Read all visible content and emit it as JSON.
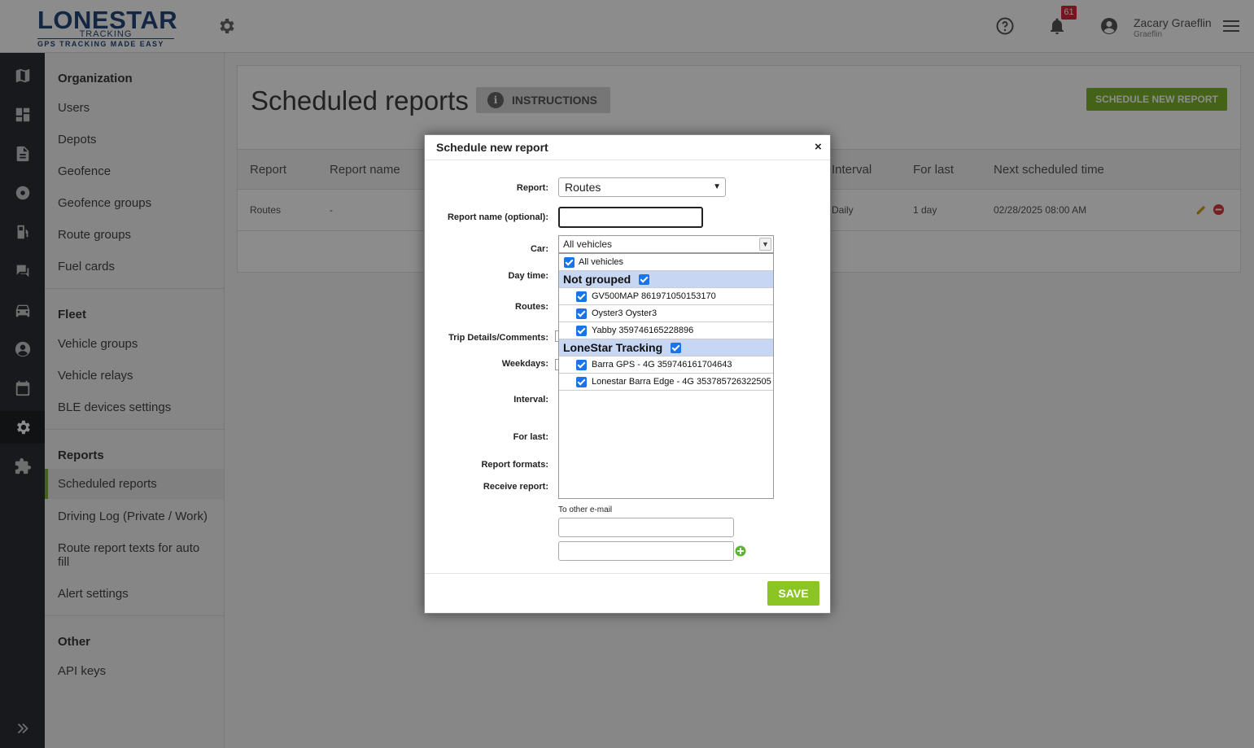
{
  "header": {
    "logo_main": "LONESTAR",
    "logo_sub": "TRACKING",
    "logo_tag": "GPS TRACKING MADE EASY",
    "notifications_count": "61",
    "user_name": "Zacary Graeflin",
    "user_sub": "Graeflin"
  },
  "rail": {
    "icons": [
      "map-icon",
      "dashboard-icon",
      "document-icon",
      "gear-icon",
      "fuel-icon",
      "chat-icon",
      "car-icon",
      "user-icon",
      "calendar-icon",
      "settings-active-icon",
      "extension-icon",
      "expand-icon"
    ]
  },
  "sidebar": {
    "sections": [
      {
        "title": "Organization",
        "items": [
          "Users",
          "Depots",
          "Geofence",
          "Geofence groups",
          "Route groups",
          "Fuel cards"
        ]
      },
      {
        "title": "Fleet",
        "items": [
          "Vehicle groups",
          "Vehicle relays",
          "BLE devices settings"
        ]
      },
      {
        "title": "Reports",
        "items": [
          "Scheduled reports",
          "Driving Log (Private / Work)",
          "Route report texts for auto fill",
          "Alert settings"
        ]
      },
      {
        "title": "Other",
        "items": [
          "API keys"
        ]
      }
    ],
    "active_item": "Scheduled reports"
  },
  "main": {
    "title": "Scheduled reports",
    "instructions_label": "INSTRUCTIONS",
    "schedule_button": "SCHEDULE NEW REPORT",
    "columns": [
      "Report",
      "Report name",
      "Interval",
      "For last",
      "Next scheduled time"
    ],
    "rows": [
      {
        "report": "Routes",
        "report_name": "-",
        "interval": "Daily",
        "for_last": "1 day",
        "next_time": "02/28/2025 08:00 AM"
      }
    ]
  },
  "modal": {
    "title": "Schedule new report",
    "close": "×",
    "labels": {
      "report": "Report:",
      "report_name": "Report name (optional):",
      "car": "Car:",
      "day_time": "Day time:",
      "routes": "Routes:",
      "trip_details": "Trip Details/Comments:",
      "weekdays": "Weekdays:",
      "interval": "Interval:",
      "for_last": "For last:",
      "report_formats": "Report formats:",
      "receive_report": "Receive report:"
    },
    "report_value": "Routes",
    "report_name_value": "",
    "car_value": "All vehicles",
    "car_options": [
      {
        "label": "All vehicles",
        "type": "all",
        "checked": true
      },
      {
        "label": "Not grouped",
        "type": "group",
        "checked": true
      },
      {
        "label": "GV500MAP 861971050153170",
        "type": "item",
        "checked": true
      },
      {
        "label": "Oyster3 Oyster3",
        "type": "item",
        "checked": true
      },
      {
        "label": "Yabby 359746165228896",
        "type": "item",
        "checked": true
      },
      {
        "label": "LoneStar Tracking",
        "type": "group",
        "checked": true
      },
      {
        "label": "Barra GPS - 4G 359746161704643",
        "type": "item",
        "checked": true
      },
      {
        "label": "Lonestar Barra Edge - 4G 353785726322505",
        "type": "item",
        "checked": true
      }
    ],
    "email_label": "To other e-mail",
    "save_label": "SAVE"
  },
  "colors": {
    "accent_green": "#7cb52a",
    "rail_dark": "#2b2f33",
    "group_highlight": "#c6d6f3",
    "checkbox_blue": "#1a73e8",
    "badge_red": "#d9263a"
  }
}
